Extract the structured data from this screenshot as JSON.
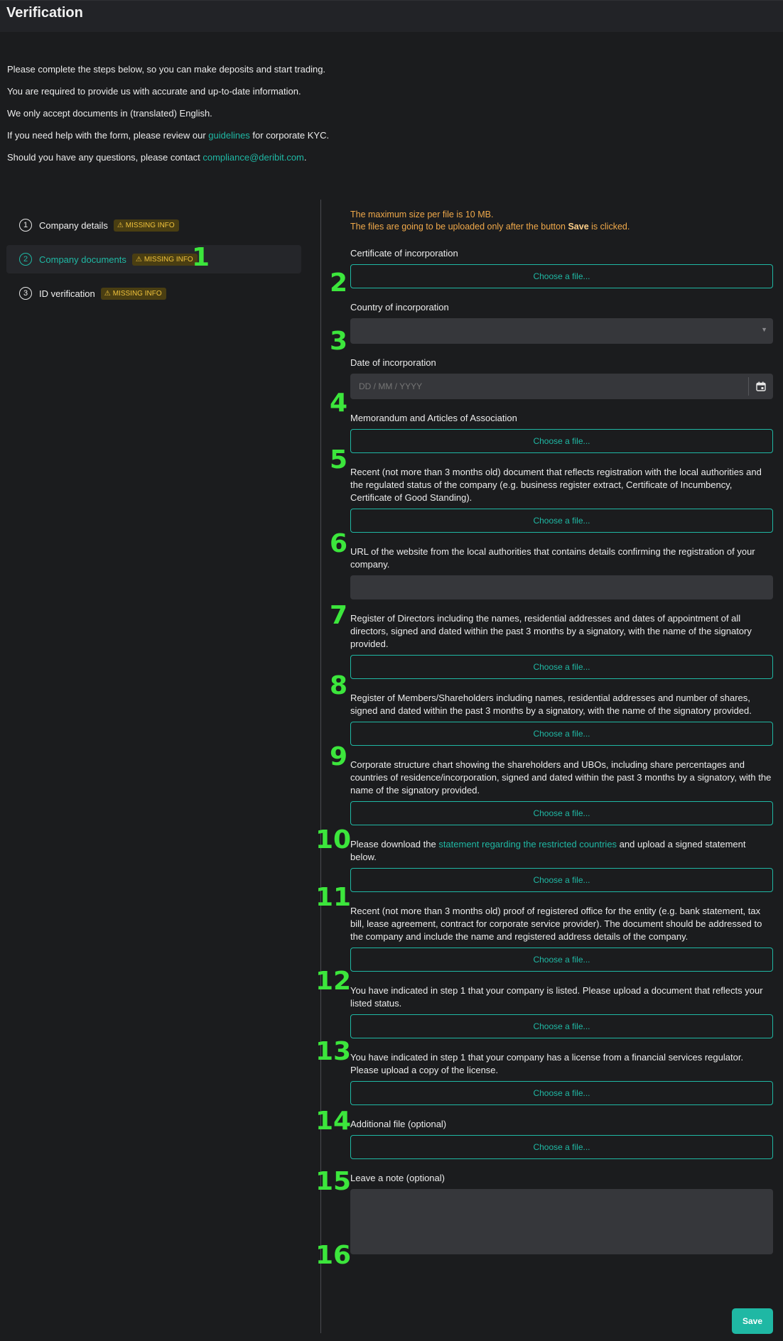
{
  "header": {
    "title": "Verification"
  },
  "intro": {
    "line1": "Please complete the steps below, so you can make deposits and start trading.",
    "line2": "You are required to provide us with accurate and up-to-date information.",
    "line3": "We only accept documents in (translated) English.",
    "line4_pre": "If you need help with the form, please review our ",
    "line4_link": "guidelines",
    "line4_post": " for corporate KYC.",
    "line5_pre": "Should you have any questions, please contact ",
    "line5_link": "compliance@deribit.com",
    "line5_post": "."
  },
  "steps": [
    {
      "num": "1",
      "label": "Company details",
      "badge": "MISSING INFO"
    },
    {
      "num": "2",
      "label": "Company documents",
      "badge": "MISSING INFO"
    },
    {
      "num": "3",
      "label": "ID verification",
      "badge": "MISSING INFO"
    }
  ],
  "notice": {
    "line1": "The maximum size per file is 10 MB.",
    "line2_pre": "The files are going to be uploaded only after the button ",
    "line2_bold": "Save",
    "line2_post": " is clicked."
  },
  "choose_file": "Choose a file...",
  "fields": {
    "cert_label": "Certificate of incorporation",
    "country_label": "Country of incorporation",
    "date_label": "Date of incorporation",
    "date_placeholder": "DD / MM / YYYY",
    "memo_label": "Memorandum and Articles of Association",
    "recent_label": "Recent (not more than 3 months old) document that reflects registration with the local authorities and the regulated status of the company (e.g. business register extract, Certificate of Incumbency, Certificate of Good Standing).",
    "url_label": "URL of the website from the local authorities that contains details confirming the registration of your company.",
    "directors_label": "Register of Directors including the names, residential addresses and dates of appointment of all directors, signed and dated within the past 3 months by a signatory, with the name of the signatory provided.",
    "members_label": "Register of Members/Shareholders including names, residential addresses and number of shares, signed and dated within the past 3 months by a signatory, with the name of the signatory provided.",
    "structure_label": "Corporate structure chart showing the shareholders and UBOs, including share percentages and countries of residence/incorporation, signed and dated within the past 3 months by a signatory, with the name of the signatory provided.",
    "restricted_pre": "Please download the ",
    "restricted_link": "statement regarding the restricted countries",
    "restricted_post": " and upload a signed statement below.",
    "office_label": "Recent (not more than 3 months old) proof of registered office for the entity (e.g. bank statement, tax bill, lease agreement, contract for corporate service provider). The document should be addressed to the company and include the name and registered address details of the company.",
    "listed_label": "You have indicated in step 1 that your company is listed. Please upload a document that reflects your listed status.",
    "license_label": "You have indicated in step 1 that your company has a license from a financial services regulator. Please upload a copy of the license.",
    "additional_label": "Additional file (optional)",
    "note_label": "Leave a note (optional)"
  },
  "save_label": "Save",
  "markers": [
    "1",
    "2",
    "3",
    "4",
    "5",
    "6",
    "7",
    "8",
    "9",
    "10",
    "11",
    "12",
    "13",
    "14",
    "15",
    "16"
  ],
  "colors": {
    "accent": "#1fb8a4",
    "warning": "#f0c23b",
    "marker": "#3ce63c"
  }
}
